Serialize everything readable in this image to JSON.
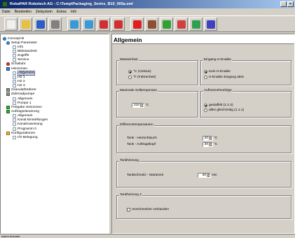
{
  "window": {
    "title": "RobaPAR Robotech AG - C:\\Temp\\Packaging_Series_B10_005a.xml",
    "min_label": "_",
    "close_label": "×"
  },
  "menu": [
    "Datei",
    "Bearbeiten",
    "Zielsystem",
    "Extras",
    "Info"
  ],
  "toolbar": {
    "buttons": [
      {
        "name": "new",
        "color": "#f0f0f0"
      },
      {
        "name": "open",
        "color": "#e8c040"
      },
      {
        "name": "save",
        "color": "#2a5ec8"
      },
      {
        "name": "print",
        "color": "#808080"
      },
      {
        "name": "upload",
        "color": "#3a9ad8"
      },
      {
        "name": "download",
        "color": "#3a9ad8"
      },
      {
        "name": "undo",
        "color": "#d03030"
      },
      {
        "name": "redo",
        "color": "#d03030"
      },
      {
        "name": "stop",
        "color": "#e02020"
      },
      {
        "name": "tools",
        "color": "#8a5030"
      },
      {
        "name": "chart",
        "color": "#30a030"
      },
      {
        "name": "filter",
        "color": "#d04040"
      },
      {
        "name": "star",
        "color": "#30a050"
      },
      {
        "name": "pen",
        "color": "#4040c0"
      }
    ]
  },
  "tree": [
    {
      "label": "Concept-B",
      "indent": 0,
      "icon": "setup"
    },
    {
      "label": "Setup Parameter",
      "indent": 1,
      "icon": "setup"
    },
    {
      "label": "Info",
      "indent": 2,
      "icon": "page"
    },
    {
      "label": "Bildstandzeit",
      "indent": 2,
      "icon": "page"
    },
    {
      "label": "Zugriffe",
      "indent": 2,
      "icon": "page"
    },
    {
      "label": "Service",
      "indent": 2,
      "icon": "page"
    },
    {
      "label": "Schaltuhr",
      "indent": 1,
      "icon": "red"
    },
    {
      "label": "Heizzonen",
      "indent": 1,
      "icon": "blue"
    },
    {
      "label": "Allgemein",
      "indent": 2,
      "icon": "page",
      "selected": true
    },
    {
      "label": "HZ 1",
      "indent": 2,
      "icon": "page"
    },
    {
      "label": "HZ 2",
      "indent": 2,
      "icon": "page"
    },
    {
      "label": "HZ 3",
      "indent": 2,
      "icon": "page"
    },
    {
      "label": "Granulatförderer",
      "indent": 1,
      "icon": "gray"
    },
    {
      "label": "Zahnradpumpe",
      "indent": 1,
      "icon": "gray"
    },
    {
      "label": "Allgemein",
      "indent": 2,
      "icon": "page"
    },
    {
      "label": "Pumpe 1",
      "indent": 2,
      "icon": "page"
    },
    {
      "label": "Freigabe Heizzonen",
      "indent": 1,
      "icon": "green"
    },
    {
      "label": "Auftragssteuerung",
      "indent": 1,
      "icon": "green"
    },
    {
      "label": "Allgemein",
      "indent": 2,
      "icon": "page"
    },
    {
      "label": "Kanal Einstellungen",
      "indent": 2,
      "icon": "page"
    },
    {
      "label": "Kanalzuweisung",
      "indent": 2,
      "icon": "page"
    },
    {
      "label": "Programm 0",
      "indent": 2,
      "icon": "page"
    },
    {
      "label": "Konfigurationen",
      "indent": 1,
      "icon": "cfg"
    },
    {
      "label": "I/O Belegung",
      "indent": 2,
      "icon": "page"
    }
  ],
  "main": {
    "title": "Allgemein",
    "masseinheit": {
      "title": "Masseinheit",
      "opt1": "°C (Celsius)",
      "opt2": "°F (Fahrenheit)"
    },
    "eingang": {
      "title": "Eingang H-Enable",
      "opt1": "Kein H-Enable",
      "opt2": "H-Enable Eingang aktiv"
    },
    "maxsoll": {
      "title": "Maximale Solltemperatur",
      "value": "210",
      "unit": "°C"
    },
    "aufheiz": {
      "title": "Aufheizreihenfolge",
      "opt1": "gestaffelt (1.2.3)",
      "opt2": "alles gleichzeitig (1.1.1)"
    },
    "diff": {
      "title": "Differenztemperaturen",
      "row1_label": "Tank - Heizschlauch",
      "row1_value": "20",
      "row2_label": "Tank - Auftragskopf",
      "row2_value": "30",
      "unit": "°C"
    },
    "tank": {
      "title": "Tankheizung",
      "label": "Tankschmelz - Wartezeit",
      "value": "30",
      "unit": "min"
    },
    "tank2": {
      "title": "Tankheizung 2",
      "check_label": "Vorschmelzer vorhanden"
    }
  },
  "status": {
    "text": "nstem beendet"
  }
}
